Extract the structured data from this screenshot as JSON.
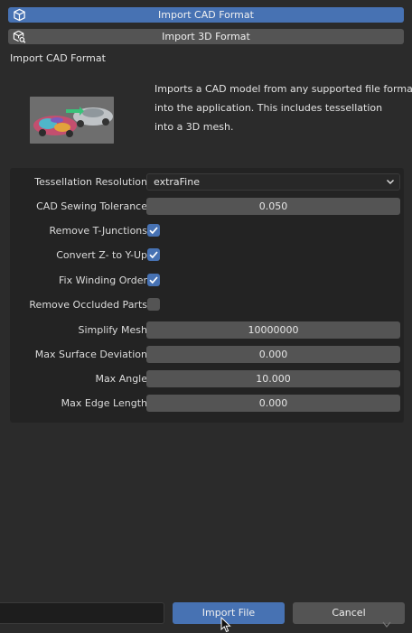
{
  "tabs": {
    "cad_label": "Import CAD Format",
    "mesh_label": "Import 3D Format"
  },
  "section_title": "Import CAD Format",
  "description": [
    "Imports a CAD model from any supported file format",
    "into the application. This includes tessellation",
    "into a 3D mesh."
  ],
  "settings": {
    "tessellation_resolution": {
      "label": "Tessellation Resolution",
      "value": "extraFine"
    },
    "cad_sewing_tolerance": {
      "label": "CAD Sewing Tolerance",
      "value": "0.050"
    },
    "remove_t_junctions": {
      "label": "Remove T-Junctions",
      "checked": true
    },
    "convert_z_to_y_up": {
      "label": "Convert Z- to Y-Up",
      "checked": true
    },
    "fix_winding_order": {
      "label": "Fix Winding Order",
      "checked": true
    },
    "remove_occluded_parts": {
      "label": "Remove Occluded Parts",
      "checked": false
    },
    "simplify_mesh": {
      "label": "Simplify Mesh",
      "value": "10000000"
    },
    "max_surface_deviation": {
      "label": "Max Surface Deviation",
      "value": "0.000"
    },
    "max_angle": {
      "label": "Max Angle",
      "value": "10.000"
    },
    "max_edge_length": {
      "label": "Max Edge Length",
      "value": "0.000"
    }
  },
  "footer": {
    "import_label": "Import File",
    "cancel_label": "Cancel"
  },
  "colors": {
    "accent": "#4772b3",
    "background": "#2b2b2b",
    "panel": "#232323",
    "field": "#545454"
  }
}
